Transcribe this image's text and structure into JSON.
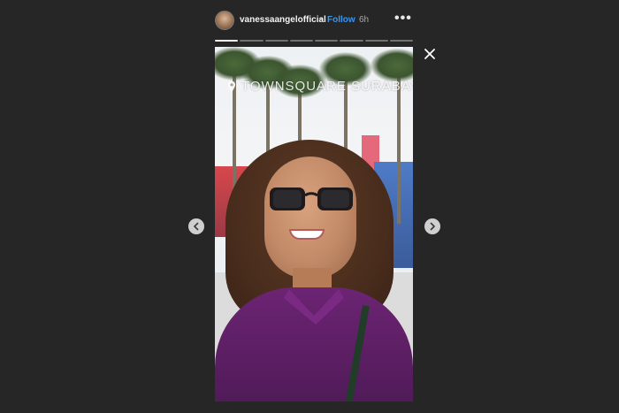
{
  "header": {
    "username": "vanessaangelofficial",
    "separator": "•",
    "follow_label": "Follow",
    "time_ago": "6h",
    "more_glyph": "•••"
  },
  "story": {
    "location_sticker": "TOWNSQUARE SURABAYA",
    "progress": {
      "segments": 8,
      "current_segment": 1
    }
  },
  "controls": {
    "close_icon": "close-icon",
    "prev_icon": "chevron-left-icon",
    "next_icon": "chevron-right-icon"
  },
  "colors": {
    "background": "#262626",
    "follow": "#3897f0"
  }
}
